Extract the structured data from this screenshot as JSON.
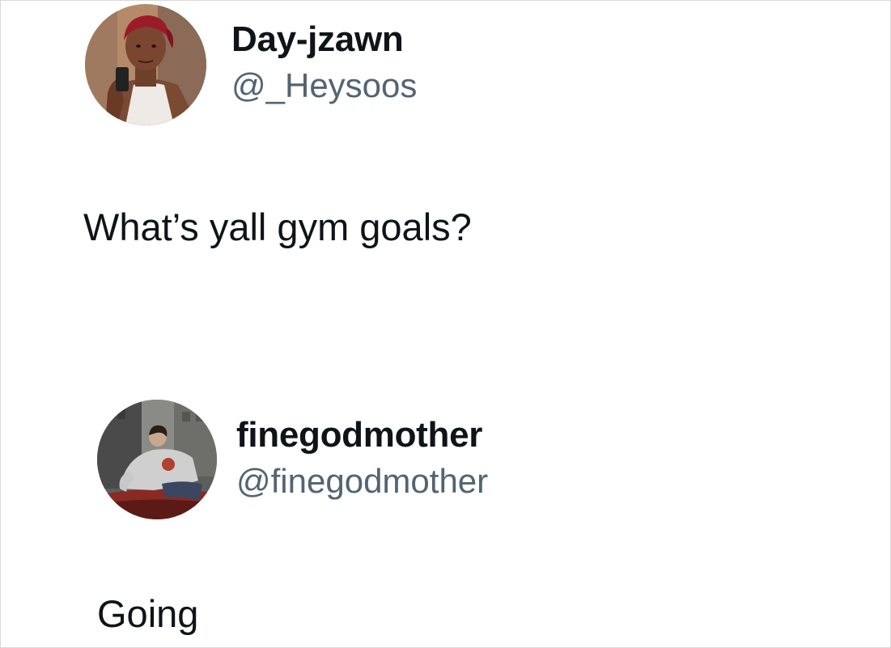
{
  "posts": [
    {
      "display_name": "Day-jzawn",
      "handle": "@_Heysoos",
      "text": "What’s yall gym goals?",
      "avatar": "profile-photo-man-selfie"
    },
    {
      "display_name": "finegodmother",
      "handle": "@finegodmother",
      "text": "Going",
      "avatar": "profile-photo-woman-sitting"
    }
  ],
  "colors": {
    "background": "#ffffff",
    "text_primary": "#0f1419",
    "text_secondary": "#536471"
  }
}
